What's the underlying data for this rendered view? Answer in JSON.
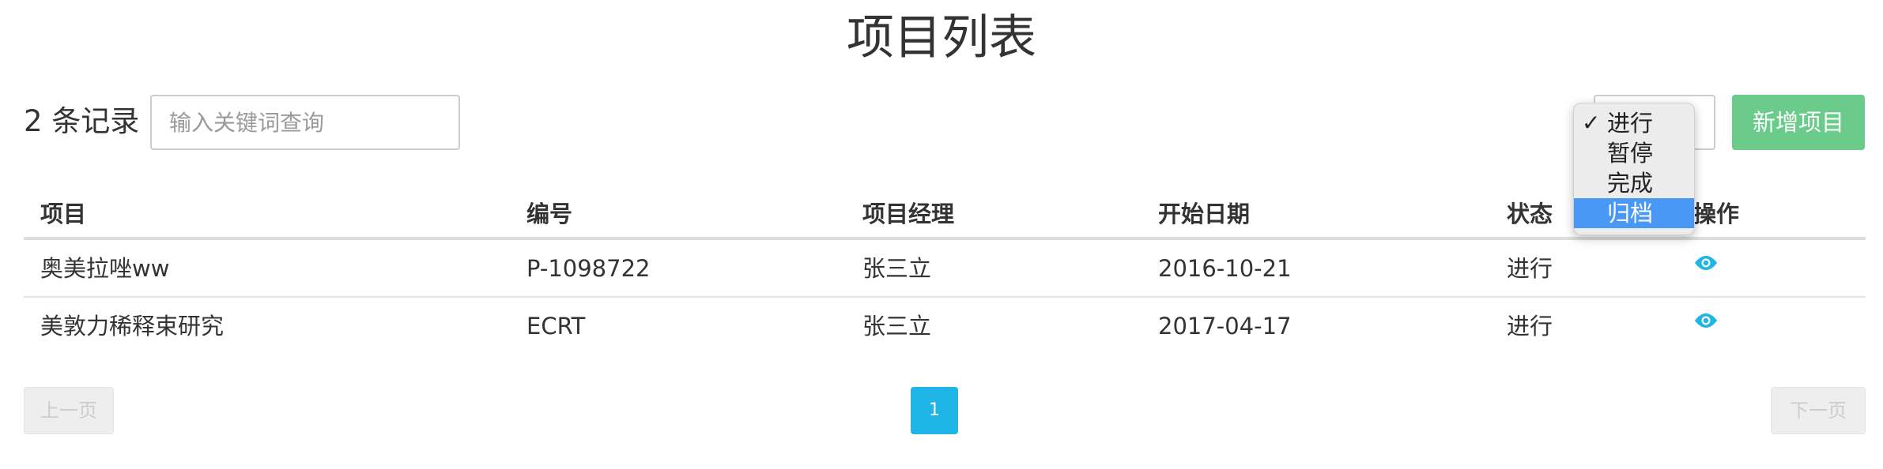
{
  "page": {
    "title": "项目列表"
  },
  "toolbar": {
    "record_count": "2",
    "record_suffix": "条记录",
    "search_placeholder": "输入关键词查询",
    "add_button_label": "新增项目",
    "add_button_color": "#6bcb8b"
  },
  "status_dropdown": {
    "options": [
      {
        "label": "进行",
        "checked": true,
        "highlighted": false
      },
      {
        "label": "暂停",
        "checked": false,
        "highlighted": false
      },
      {
        "label": "完成",
        "checked": false,
        "highlighted": false
      },
      {
        "label": "归档",
        "checked": false,
        "highlighted": true
      }
    ],
    "check_mark": "✓",
    "highlight_color": "#4a98f5"
  },
  "table": {
    "headers": [
      "项目",
      "编号",
      "项目经理",
      "开始日期",
      "状态",
      "操作"
    ],
    "rows": [
      {
        "project": "奥美拉唑ww",
        "code": "P-1098722",
        "manager": "张三立",
        "start_date": "2016-10-21",
        "status": "进行",
        "action_icon": "eye-icon"
      },
      {
        "project": "美敦力稀释束研究",
        "code": "ECRT",
        "manager": "张三立",
        "start_date": "2017-04-17",
        "status": "进行",
        "action_icon": "eye-icon"
      }
    ],
    "action_icon_color": "#1fb5e6"
  },
  "pagination": {
    "prev_label": "上一页",
    "current_page": "1",
    "next_label": "下一页",
    "active_color": "#1fb5e6"
  }
}
